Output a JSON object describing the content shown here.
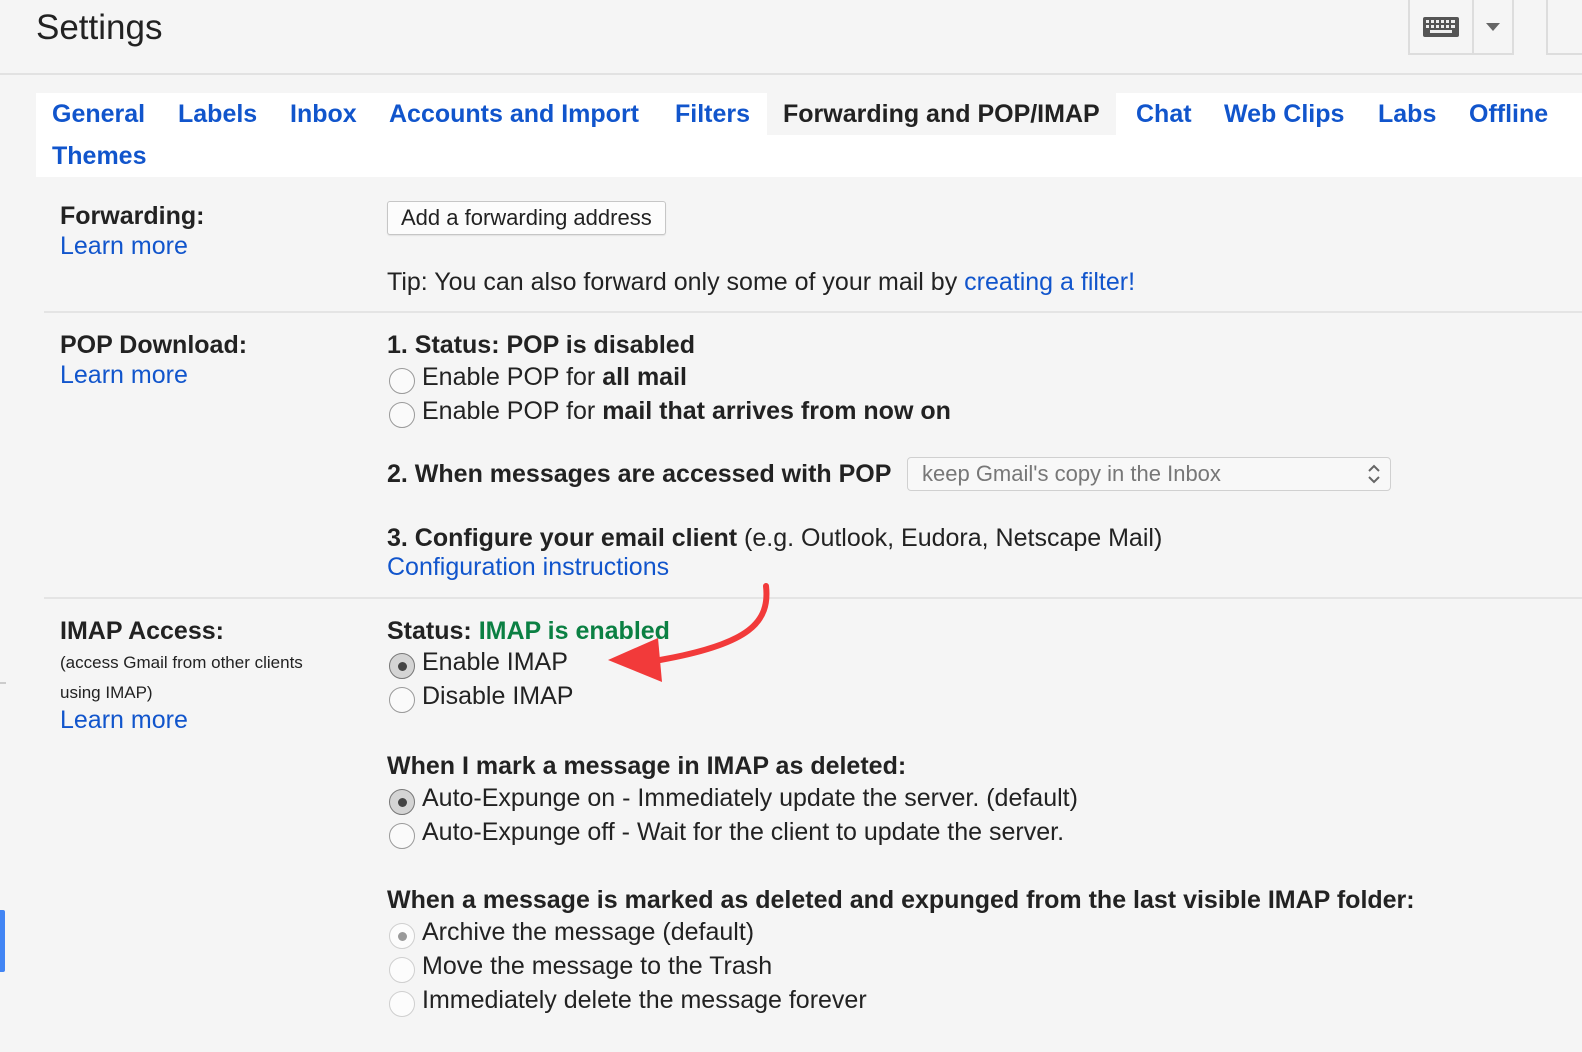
{
  "header": {
    "title": "Settings"
  },
  "tabs": [
    {
      "label": "General",
      "active": false
    },
    {
      "label": "Labels",
      "active": false
    },
    {
      "label": "Inbox",
      "active": false
    },
    {
      "label": "Accounts and Import",
      "active": false
    },
    {
      "label": "Filters",
      "active": false
    },
    {
      "label": "Forwarding and POP/IMAP",
      "active": true
    },
    {
      "label": "Chat",
      "active": false
    },
    {
      "label": "Web Clips",
      "active": false
    },
    {
      "label": "Labs",
      "active": false
    },
    {
      "label": "Offline",
      "active": false
    },
    {
      "label": "Themes",
      "active": false
    }
  ],
  "forwarding": {
    "label": "Forwarding:",
    "learn_more": "Learn more",
    "add_button": "Add a forwarding address",
    "tip_prefix": "Tip: You can also forward only some of your mail by ",
    "tip_link": "creating a filter!"
  },
  "pop": {
    "label": "POP Download:",
    "learn_more": "Learn more",
    "status": "1. Status: POP is disabled",
    "option1_prefix": "Enable POP for ",
    "option1_bold": "all mail",
    "option2_prefix": "Enable POP for ",
    "option2_bold": "mail that arrives from now on",
    "accessed_label": "2. When messages are accessed with POP",
    "accessed_value": "keep Gmail's copy in the Inbox",
    "configure_bold": "3. Configure your email client",
    "configure_rest": " (e.g. Outlook, Eudora, Netscape Mail)",
    "config_link": "Configuration instructions"
  },
  "imap": {
    "label": "IMAP Access:",
    "desc_line1": "(access Gmail from other clients",
    "desc_line2": "using IMAP)",
    "learn_more": "Learn more",
    "status_prefix": "Status: ",
    "status_value": "IMAP is enabled",
    "enable": "Enable IMAP",
    "disable": "Disable IMAP",
    "enabled_selected": true,
    "deleted_heading": "When I mark a message in IMAP as deleted:",
    "expunge_on": "Auto-Expunge on - Immediately update the server. (default)",
    "expunge_off": "Auto-Expunge off - Wait for the client to update the server.",
    "expunged_heading": "When a message is marked as deleted and expunged from the last visible IMAP folder:",
    "archive": "Archive the message (default)",
    "trash": "Move the message to the Trash",
    "delete_forever": "Immediately delete the message forever"
  },
  "colors": {
    "link": "#1155cc",
    "enabled_green": "#0b8043",
    "arrow": "#f23a3a"
  },
  "icons": [
    "keyboard-icon",
    "chevron-down-icon",
    "select-arrows-icon",
    "annotation-arrow"
  ]
}
